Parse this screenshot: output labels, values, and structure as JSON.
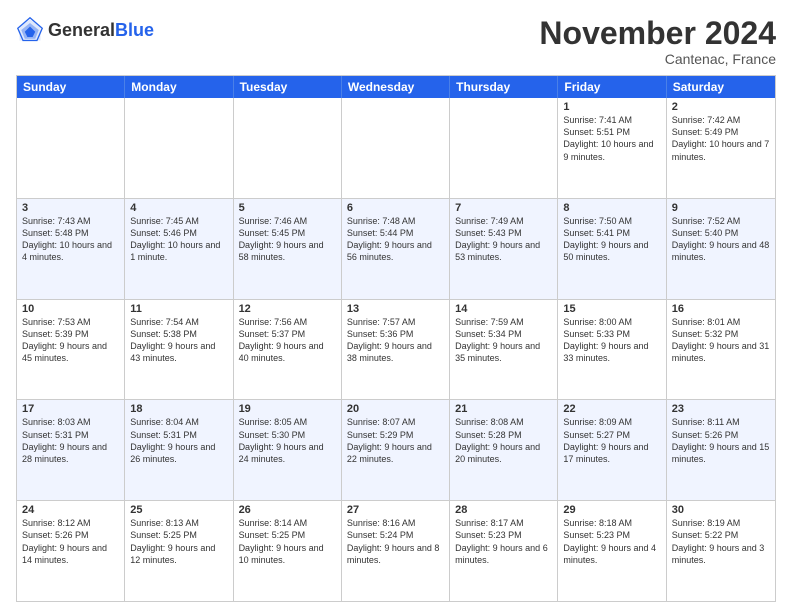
{
  "header": {
    "logo_general": "General",
    "logo_blue": "Blue",
    "month_title": "November 2024",
    "location": "Cantenac, France"
  },
  "weekdays": [
    "Sunday",
    "Monday",
    "Tuesday",
    "Wednesday",
    "Thursday",
    "Friday",
    "Saturday"
  ],
  "rows": [
    {
      "alt": false,
      "cells": [
        {
          "empty": true
        },
        {
          "empty": true
        },
        {
          "empty": true
        },
        {
          "empty": true
        },
        {
          "empty": true
        },
        {
          "day": "1",
          "info": "Sunrise: 7:41 AM\nSunset: 5:51 PM\nDaylight: 10 hours and 9 minutes."
        },
        {
          "day": "2",
          "info": "Sunrise: 7:42 AM\nSunset: 5:49 PM\nDaylight: 10 hours and 7 minutes."
        }
      ]
    },
    {
      "alt": true,
      "cells": [
        {
          "day": "3",
          "info": "Sunrise: 7:43 AM\nSunset: 5:48 PM\nDaylight: 10 hours and 4 minutes."
        },
        {
          "day": "4",
          "info": "Sunrise: 7:45 AM\nSunset: 5:46 PM\nDaylight: 10 hours and 1 minute."
        },
        {
          "day": "5",
          "info": "Sunrise: 7:46 AM\nSunset: 5:45 PM\nDaylight: 9 hours and 58 minutes."
        },
        {
          "day": "6",
          "info": "Sunrise: 7:48 AM\nSunset: 5:44 PM\nDaylight: 9 hours and 56 minutes."
        },
        {
          "day": "7",
          "info": "Sunrise: 7:49 AM\nSunset: 5:43 PM\nDaylight: 9 hours and 53 minutes."
        },
        {
          "day": "8",
          "info": "Sunrise: 7:50 AM\nSunset: 5:41 PM\nDaylight: 9 hours and 50 minutes."
        },
        {
          "day": "9",
          "info": "Sunrise: 7:52 AM\nSunset: 5:40 PM\nDaylight: 9 hours and 48 minutes."
        }
      ]
    },
    {
      "alt": false,
      "cells": [
        {
          "day": "10",
          "info": "Sunrise: 7:53 AM\nSunset: 5:39 PM\nDaylight: 9 hours and 45 minutes."
        },
        {
          "day": "11",
          "info": "Sunrise: 7:54 AM\nSunset: 5:38 PM\nDaylight: 9 hours and 43 minutes."
        },
        {
          "day": "12",
          "info": "Sunrise: 7:56 AM\nSunset: 5:37 PM\nDaylight: 9 hours and 40 minutes."
        },
        {
          "day": "13",
          "info": "Sunrise: 7:57 AM\nSunset: 5:36 PM\nDaylight: 9 hours and 38 minutes."
        },
        {
          "day": "14",
          "info": "Sunrise: 7:59 AM\nSunset: 5:34 PM\nDaylight: 9 hours and 35 minutes."
        },
        {
          "day": "15",
          "info": "Sunrise: 8:00 AM\nSunset: 5:33 PM\nDaylight: 9 hours and 33 minutes."
        },
        {
          "day": "16",
          "info": "Sunrise: 8:01 AM\nSunset: 5:32 PM\nDaylight: 9 hours and 31 minutes."
        }
      ]
    },
    {
      "alt": true,
      "cells": [
        {
          "day": "17",
          "info": "Sunrise: 8:03 AM\nSunset: 5:31 PM\nDaylight: 9 hours and 28 minutes."
        },
        {
          "day": "18",
          "info": "Sunrise: 8:04 AM\nSunset: 5:31 PM\nDaylight: 9 hours and 26 minutes."
        },
        {
          "day": "19",
          "info": "Sunrise: 8:05 AM\nSunset: 5:30 PM\nDaylight: 9 hours and 24 minutes."
        },
        {
          "day": "20",
          "info": "Sunrise: 8:07 AM\nSunset: 5:29 PM\nDaylight: 9 hours and 22 minutes."
        },
        {
          "day": "21",
          "info": "Sunrise: 8:08 AM\nSunset: 5:28 PM\nDaylight: 9 hours and 20 minutes."
        },
        {
          "day": "22",
          "info": "Sunrise: 8:09 AM\nSunset: 5:27 PM\nDaylight: 9 hours and 17 minutes."
        },
        {
          "day": "23",
          "info": "Sunrise: 8:11 AM\nSunset: 5:26 PM\nDaylight: 9 hours and 15 minutes."
        }
      ]
    },
    {
      "alt": false,
      "cells": [
        {
          "day": "24",
          "info": "Sunrise: 8:12 AM\nSunset: 5:26 PM\nDaylight: 9 hours and 14 minutes."
        },
        {
          "day": "25",
          "info": "Sunrise: 8:13 AM\nSunset: 5:25 PM\nDaylight: 9 hours and 12 minutes."
        },
        {
          "day": "26",
          "info": "Sunrise: 8:14 AM\nSunset: 5:25 PM\nDaylight: 9 hours and 10 minutes."
        },
        {
          "day": "27",
          "info": "Sunrise: 8:16 AM\nSunset: 5:24 PM\nDaylight: 9 hours and 8 minutes."
        },
        {
          "day": "28",
          "info": "Sunrise: 8:17 AM\nSunset: 5:23 PM\nDaylight: 9 hours and 6 minutes."
        },
        {
          "day": "29",
          "info": "Sunrise: 8:18 AM\nSunset: 5:23 PM\nDaylight: 9 hours and 4 minutes."
        },
        {
          "day": "30",
          "info": "Sunrise: 8:19 AM\nSunset: 5:22 PM\nDaylight: 9 hours and 3 minutes."
        }
      ]
    }
  ]
}
